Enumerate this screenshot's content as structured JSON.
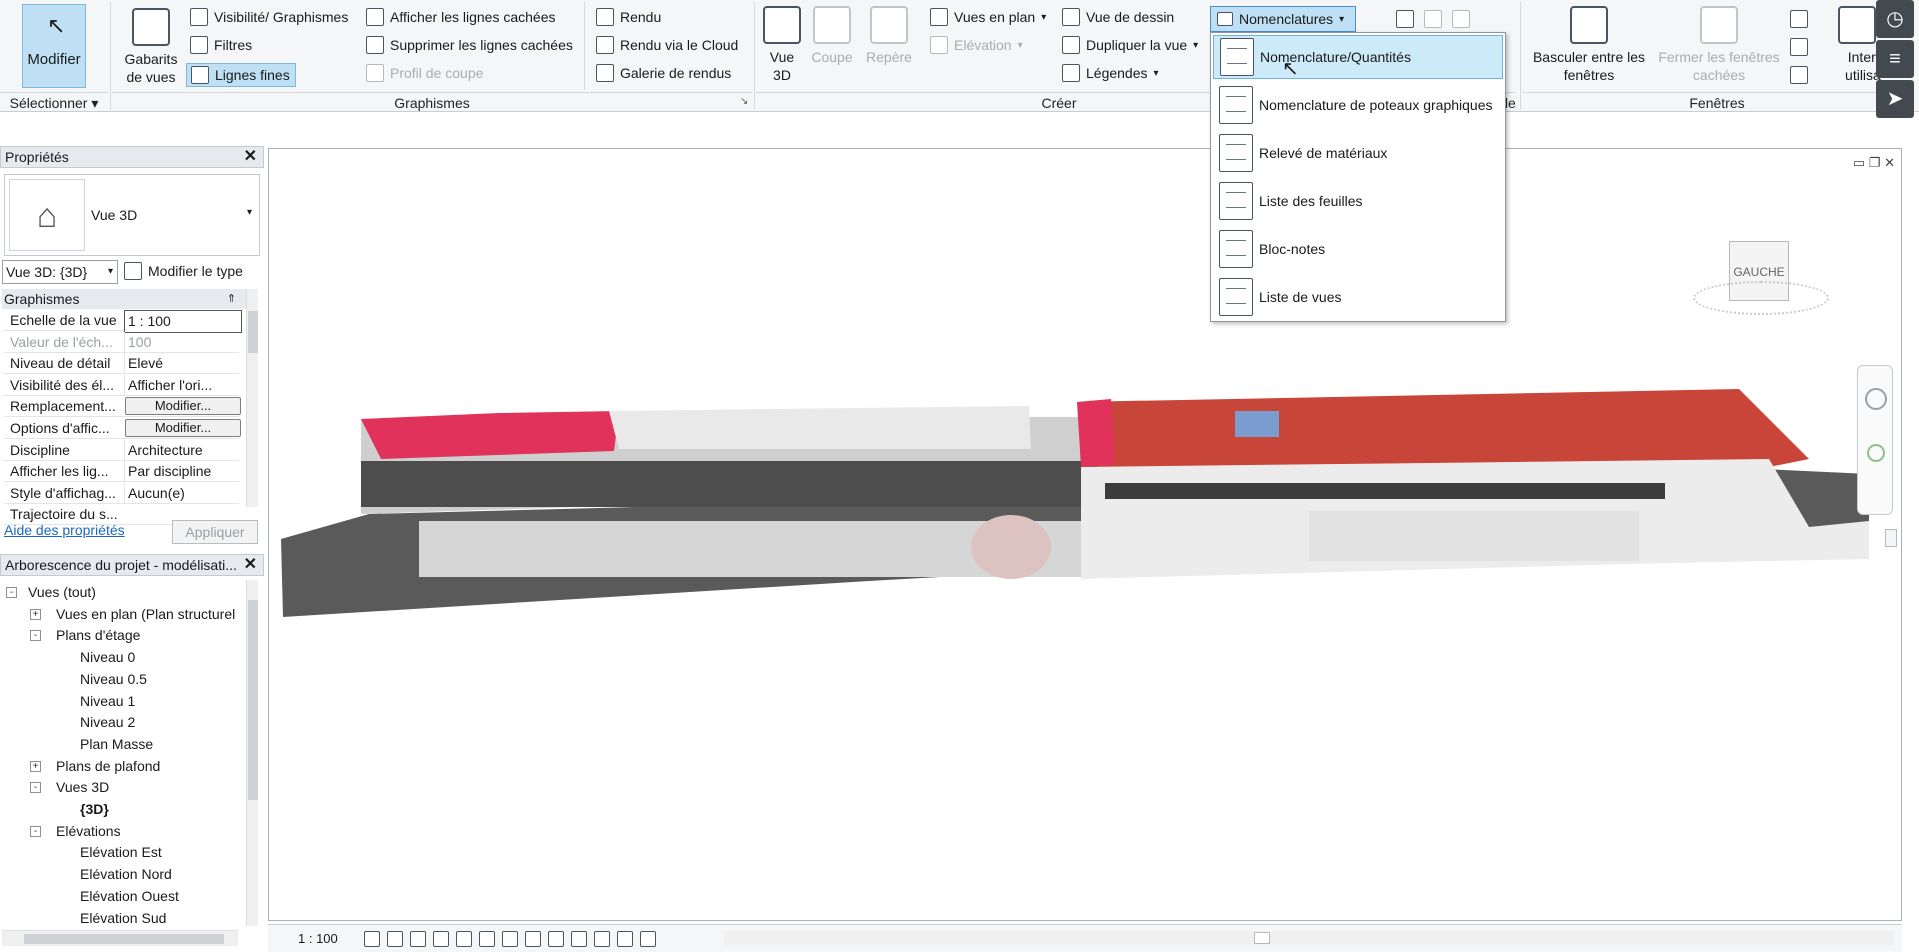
{
  "ribbon": {
    "selectionner": {
      "modifier": "Modifier",
      "group": "Sélectionner"
    },
    "graphismes": {
      "group": "Graphismes",
      "gabarits": "Gabarits de vues",
      "visibilite": "Visibilité/ Graphismes",
      "filtres": "Filtres",
      "lignes_fines": "Lignes fines",
      "afficher_cachees": "Afficher les lignes cachées",
      "supprimer_cachees": "Supprimer les lignes cachées",
      "profil_coupe": "Profil de coupe",
      "rendu": "Rendu",
      "rendu_cloud": "Rendu  via le Cloud",
      "galerie": "Galerie  de rendus"
    },
    "creer": {
      "group": "Créer",
      "vue3d": "Vue 3D",
      "coupe": "Coupe",
      "repere": "Repère",
      "vues_plan": "Vues en plan",
      "elevation": "Elévation",
      "vue_dessin": "Vue de dessin",
      "dupliquer": "Dupliquer la vue",
      "legendes": "Légendes",
      "nomenclatures": "Nomenclatures"
    },
    "fenetres": {
      "group": "Fenêtres",
      "basculer": "Basculer entre les fenêtres",
      "fermer": "Fermer les fenêtres cachées",
      "interface": "Interface utilisateur",
      "partial_group": "de"
    }
  },
  "dropdown": {
    "items": [
      "Nomenclature/Quantités",
      "Nomenclature de poteaux graphiques",
      "Relevé de matériaux",
      "Liste des feuilles",
      "Bloc-notes",
      "Liste de vues"
    ]
  },
  "properties": {
    "title": "Propriétés",
    "type_name": "Vue 3D",
    "instance_select": "Vue 3D: {3D}",
    "modify_type": "Modifier le type",
    "section": "Graphismes",
    "rows": [
      {
        "k": "Echelle de la vue",
        "v": "1 : 100"
      },
      {
        "k": "Valeur de l'éch...",
        "v": "100"
      },
      {
        "k": "Niveau de détail",
        "v": "Elevé"
      },
      {
        "k": "Visibilité des él...",
        "v": "Afficher l'ori..."
      },
      {
        "k": "Remplacement...",
        "v": "Modifier..."
      },
      {
        "k": "Options d'affic...",
        "v": "Modifier..."
      },
      {
        "k": "Discipline",
        "v": "Architecture"
      },
      {
        "k": "Afficher les lig...",
        "v": "Par discipline"
      },
      {
        "k": "Style d'affichag...",
        "v": "Aucun(e)"
      },
      {
        "k": "Trajectoire du s...",
        "v": ""
      }
    ],
    "help_link": "Aide des propriétés",
    "apply": "Appliquer"
  },
  "project_browser": {
    "title": "Arborescence du projet - modélisati...",
    "nodes": [
      {
        "label": "Vues (tout)",
        "bold": false
      },
      {
        "label": "Vues en plan (Plan structurel"
      },
      {
        "label": "Plans d'étage"
      },
      {
        "label": "Niveau 0"
      },
      {
        "label": "Niveau 0.5"
      },
      {
        "label": "Niveau 1"
      },
      {
        "label": "Niveau 2"
      },
      {
        "label": "Plan Masse"
      },
      {
        "label": "Plans de plafond"
      },
      {
        "label": "Vues 3D"
      },
      {
        "label": "{3D}"
      },
      {
        "label": "Elévations"
      },
      {
        "label": "Elévation Est"
      },
      {
        "label": "Elévation Nord"
      },
      {
        "label": "Elévation Ouest"
      },
      {
        "label": "Elévation Sud"
      }
    ]
  },
  "viewcube": {
    "face": "GAUCHE"
  },
  "statusbar": {
    "scale": "1 : 100"
  },
  "colors": {
    "accent": "#bfe0f4",
    "accent_border": "#4a90c8",
    "roof_red": "#c8453a",
    "pink": "#e0325a"
  }
}
